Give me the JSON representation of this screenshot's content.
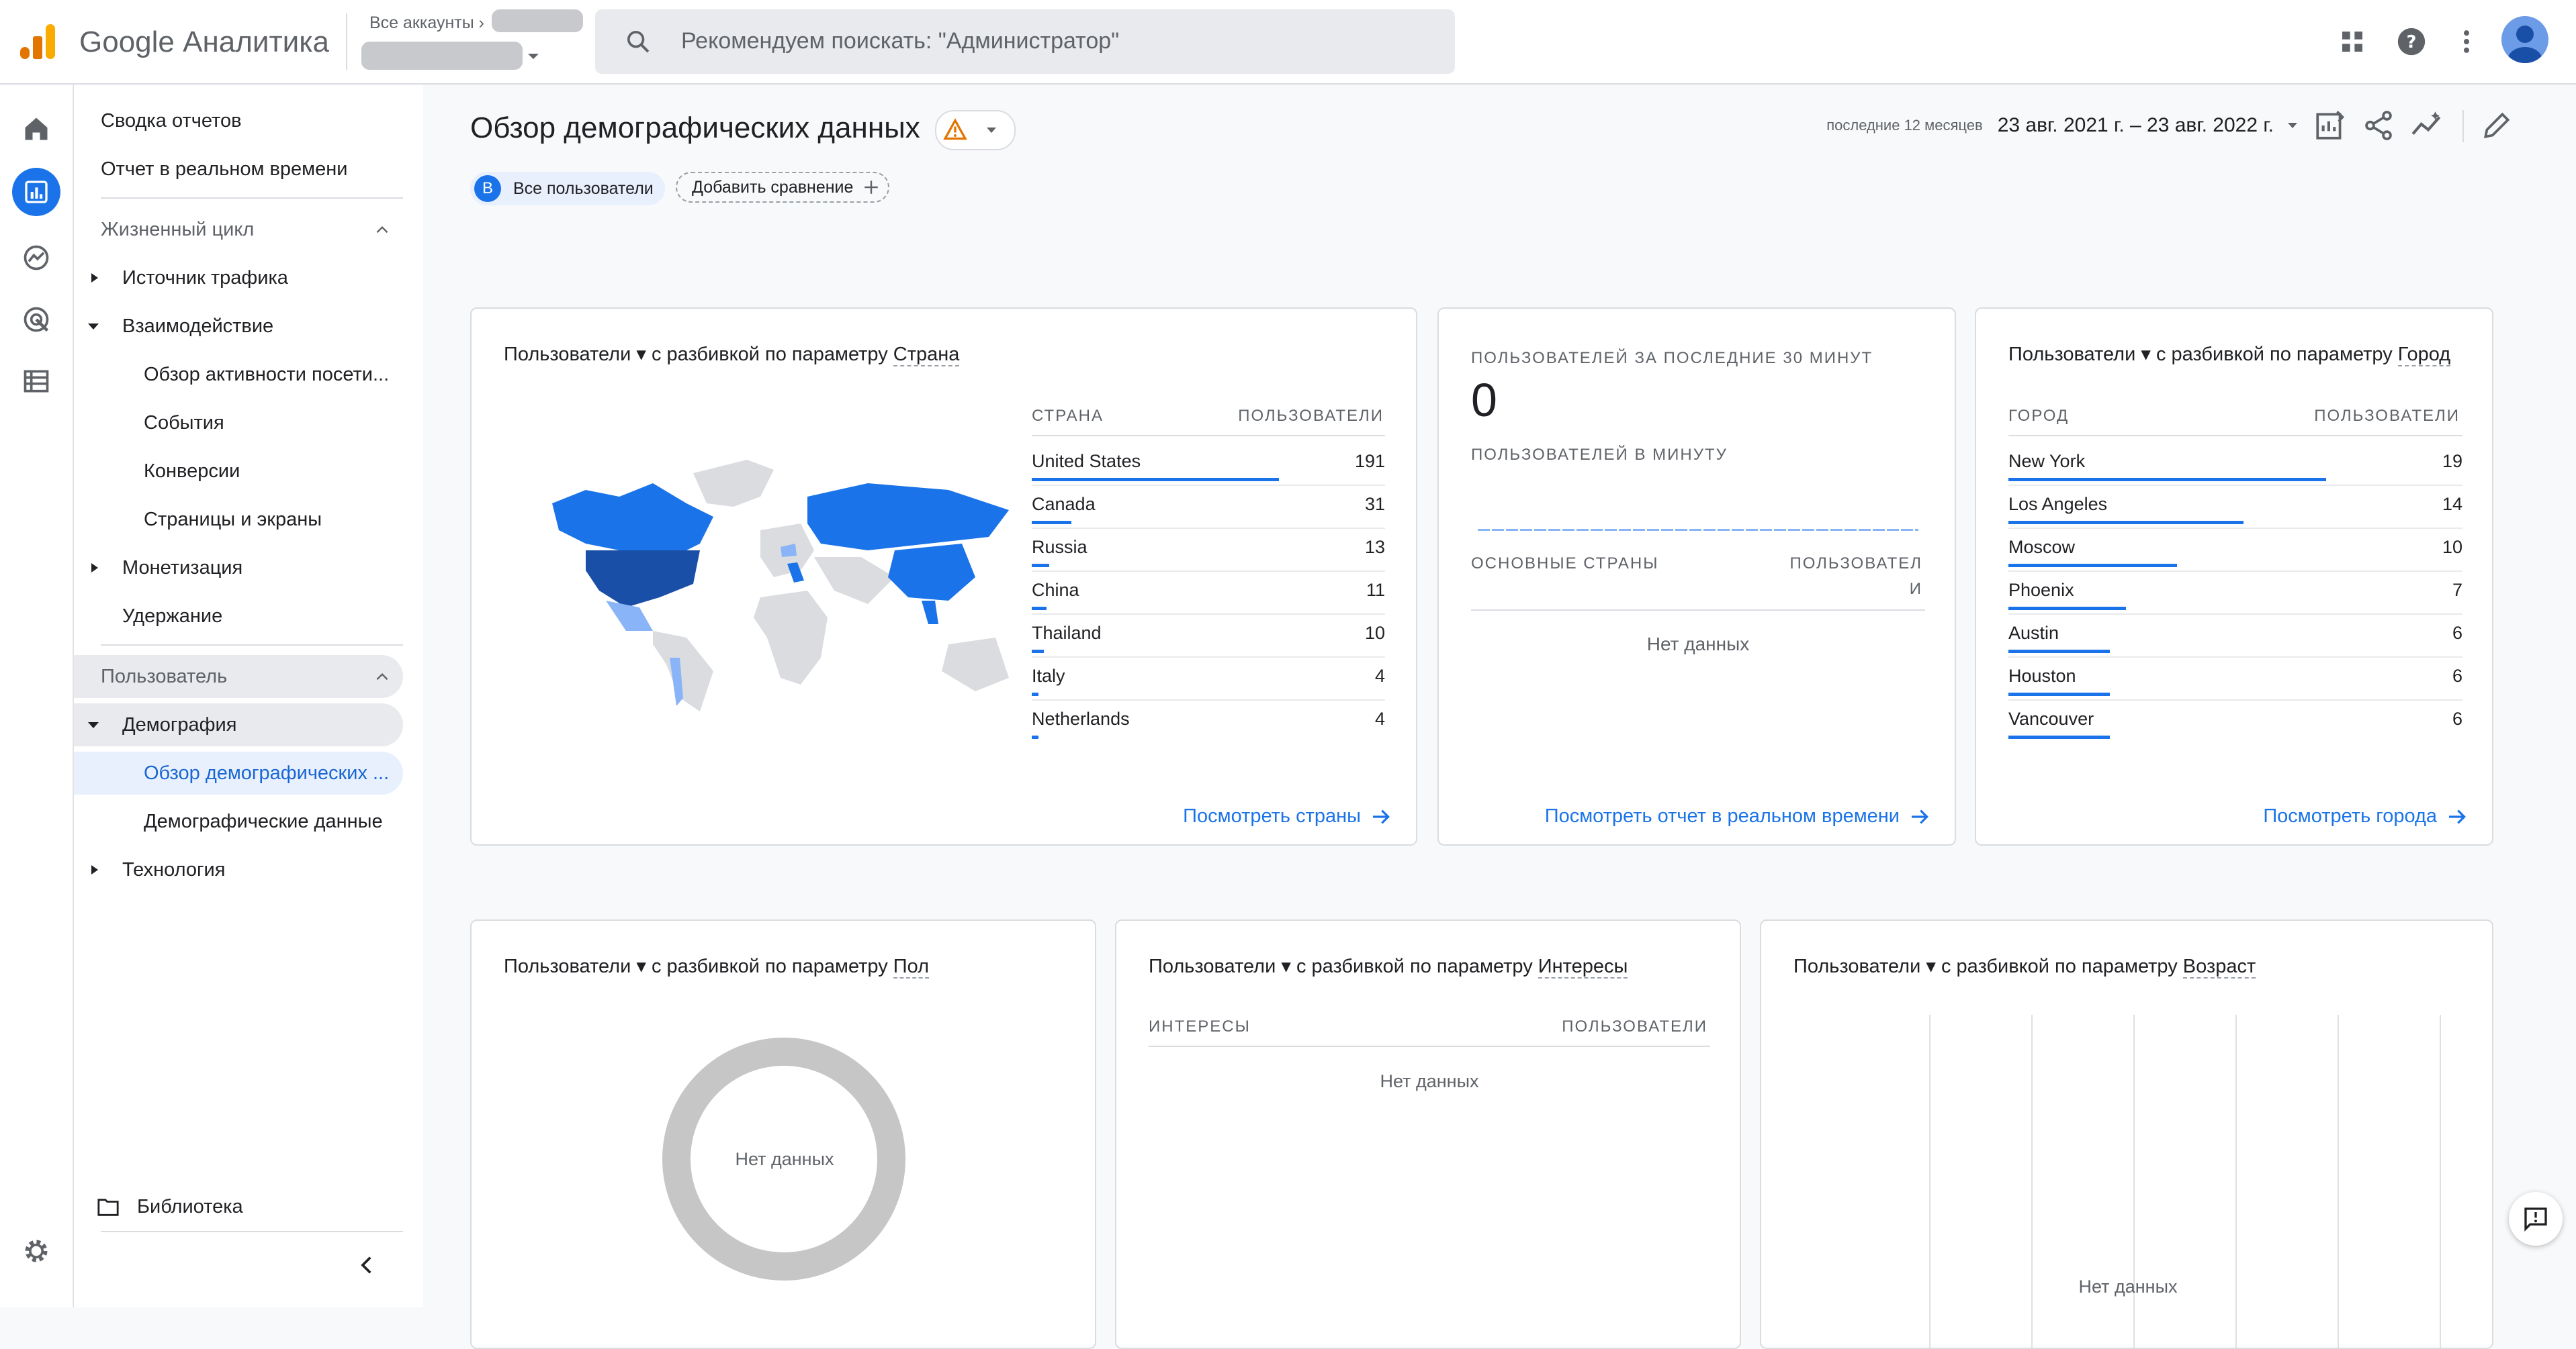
{
  "app": {
    "logo_word1": "Google",
    "logo_word2": "Аналитика",
    "account_crumb": "Все аккаунты",
    "search_placeholder": "Рекомендуем поискать: \"Администратор\""
  },
  "nav": {
    "summary": "Сводка отчетов",
    "realtime": "Отчет в реальном времени",
    "lifecycle": "Жизненный цикл",
    "traffic": "Источник трафика",
    "engagement": "Взаимодействие",
    "engagement_overview": "Обзор активности посети...",
    "events": "События",
    "conversions": "Конверсии",
    "pages": "Страницы и экраны",
    "monetization": "Монетизация",
    "retention": "Удержание",
    "user": "Пользователь",
    "demographics": "Демография",
    "demo_overview": "Обзор демографических ...",
    "demo_details": "Демографические данные",
    "tech": "Технология",
    "library": "Библиотека"
  },
  "header": {
    "title": "Обзор демографических данных",
    "segment_badge": "В",
    "segment_label": "Все пользователи",
    "add_compare": "Добавить сравнение",
    "date_preset": "последние 12 месяцев",
    "date_range": "23 авг. 2021 г. – 23 авг. 2022 г."
  },
  "country_card": {
    "metric": "Пользователи",
    "by": "с разбивкой по параметру",
    "dimension": "Страна",
    "col_dim": "СТРАНА",
    "col_metric": "ПОЛЬЗОВАТЕЛИ",
    "rows": [
      {
        "name": "United States",
        "value": "191",
        "share": 1.0
      },
      {
        "name": "Canada",
        "value": "31",
        "share": 0.16
      },
      {
        "name": "Russia",
        "value": "13",
        "share": 0.07
      },
      {
        "name": "China",
        "value": "11",
        "share": 0.06
      },
      {
        "name": "Thailand",
        "value": "10",
        "share": 0.05
      },
      {
        "name": "Italy",
        "value": "4",
        "share": 0.02
      },
      {
        "name": "Netherlands",
        "value": "4",
        "share": 0.02
      }
    ],
    "link": "Посмотреть страны"
  },
  "realtime_card": {
    "label_30": "ПОЛЬЗОВАТЕЛЕЙ ЗА ПОСЛЕДНИЕ 30 МИНУТ",
    "value": "0",
    "label_min": "ПОЛЬЗОВАТЕЛЕЙ В МИНУТУ",
    "col_dim": "ОСНОВНЫЕ СТРАНЫ",
    "col_metric_1": "ПОЛЬЗОВАТЕЛ",
    "col_metric_2": "И",
    "empty": "Нет данных",
    "link": "Посмотреть отчет в реальном времени"
  },
  "city_card": {
    "metric": "Пользователи",
    "by": "с разбивкой по параметру",
    "dimension": "Город",
    "col_dim": "ГОРОД",
    "col_metric": "ПОЛЬЗОВАТЕЛИ",
    "rows": [
      {
        "name": "New York",
        "value": "19",
        "share": 1.0
      },
      {
        "name": "Los Angeles",
        "value": "14",
        "share": 0.74
      },
      {
        "name": "Moscow",
        "value": "10",
        "share": 0.53
      },
      {
        "name": "Phoenix",
        "value": "7",
        "share": 0.37
      },
      {
        "name": "Austin",
        "value": "6",
        "share": 0.32
      },
      {
        "name": "Houston",
        "value": "6",
        "share": 0.32
      },
      {
        "name": "Vancouver",
        "value": "6",
        "share": 0.32
      }
    ],
    "link": "Посмотреть города"
  },
  "gender_card": {
    "metric": "Пользователи",
    "by": "с разбивкой по параметру",
    "dimension": "Пол",
    "empty": "Нет данных"
  },
  "interests_card": {
    "metric": "Пользователи",
    "by": "с разбивкой по параметру",
    "dimension": "Интересы",
    "col_dim": "ИНТЕРЕСЫ",
    "col_metric": "ПОЛЬЗОВАТЕЛИ",
    "empty": "Нет данных"
  },
  "age_card": {
    "metric": "Пользователи",
    "by": "с разбивкой по параметру",
    "dimension": "Возраст",
    "empty": "Нет данных"
  },
  "colors": {
    "accent": "#1a73e8",
    "map_dark": "#1a4fa8",
    "map_mid": "#1a73e8",
    "map_light": "#8ab4f8",
    "map_none": "#dadce0",
    "warning": "#e37400"
  }
}
